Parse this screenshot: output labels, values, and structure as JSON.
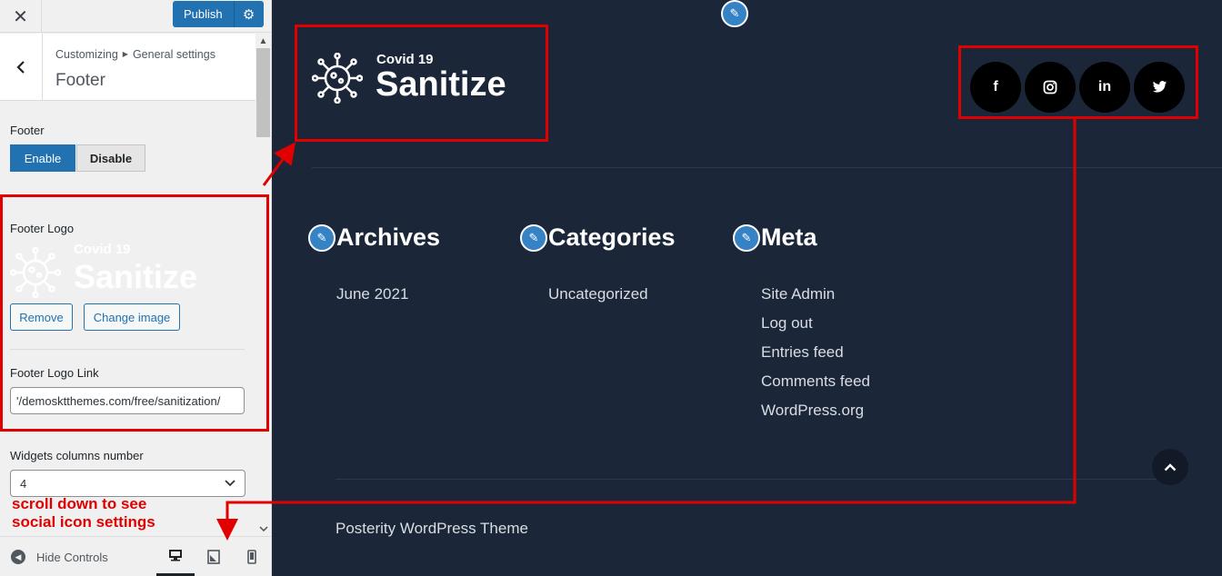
{
  "topbar": {
    "close_label": "✕",
    "publish_label": "Publish"
  },
  "section": {
    "breadcrumb_parent": "Customizing",
    "breadcrumb_child": "General settings",
    "title": "Footer"
  },
  "footer_toggle": {
    "label": "Footer",
    "enable_label": "Enable",
    "disable_label": "Disable"
  },
  "footer_logo": {
    "label": "Footer Logo",
    "logo_small": "Covid 19",
    "logo_big": "Sanitize",
    "remove_label": "Remove",
    "change_label": "Change image"
  },
  "footer_logo_link": {
    "label": "Footer Logo Link",
    "value": "'/demosktthemes.com/free/sanitization/"
  },
  "widgets_columns": {
    "label": "Widgets columns number",
    "value": "4"
  },
  "annotation": {
    "line1": "scroll down to see",
    "line2": "social icon settings"
  },
  "controls": {
    "hide_label": "Hide Controls"
  },
  "preview": {
    "logo_small": "Covid 19",
    "logo_big": "Sanitize",
    "social": [
      {
        "icon": "facebook-icon",
        "glyph": "f"
      },
      {
        "icon": "instagram-icon",
        "glyph": "◎"
      },
      {
        "icon": "linkedin-icon",
        "glyph": "in"
      },
      {
        "icon": "twitter-icon",
        "glyph": "🐦"
      }
    ],
    "widgets": [
      {
        "title": "Archives",
        "links": [
          "June 2021"
        ]
      },
      {
        "title": "Categories",
        "links": [
          "Uncategorized"
        ]
      },
      {
        "title": "Meta",
        "links": [
          "Site Admin",
          "Log out",
          "Entries feed",
          "Comments feed",
          "WordPress.org"
        ]
      }
    ],
    "credit": "Posterity WordPress Theme"
  },
  "colors": {
    "accent": "#2271b1",
    "annotation": "#e00000",
    "preview_bg": "#1b2738"
  }
}
